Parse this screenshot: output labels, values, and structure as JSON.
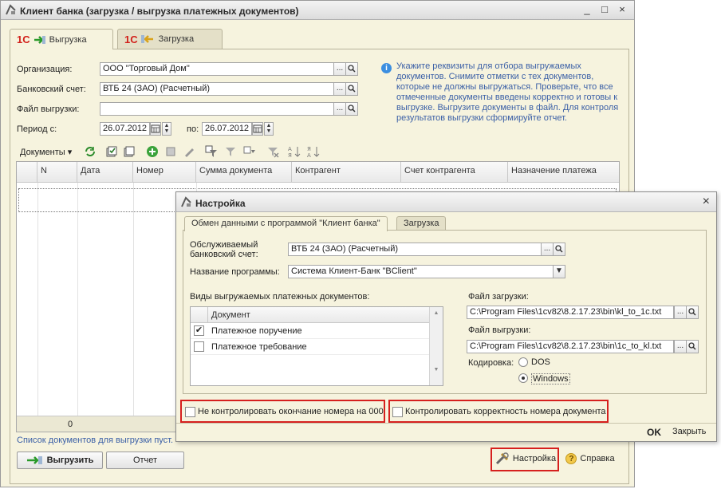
{
  "main_window": {
    "title": "Клиент банка (загрузка / выгрузка платежных документов)",
    "controls": {
      "minimize": "_",
      "maximize": "□",
      "close": "×"
    }
  },
  "tabs": [
    {
      "logo": "1С",
      "label": "Выгрузка",
      "active": true
    },
    {
      "logo": "1С",
      "label": "Загрузка",
      "active": false
    }
  ],
  "form": {
    "organization": {
      "label": "Организация:",
      "value": "ООО \"Торговый Дом\""
    },
    "bank_account": {
      "label": "Банковский счет:",
      "value": "ВТБ 24 (ЗАО) (Расчетный)"
    },
    "export_file": {
      "label": "Файл выгрузки:",
      "value": ""
    },
    "period": {
      "label_from": "Период с:",
      "from": "26.07.2012",
      "label_to": "по:",
      "to": "26.07.2012"
    },
    "select_button": "...",
    "search_icon": "magnifier-icon"
  },
  "info_text": "Укажите реквизиты для отбора выгружаемых документов. Снимите отметки с тех документов, которые не должны выгружаться. Проверьте, что все отмеченные документы введены корректно и готовы к выгрузке. Выгрузите документы в файл. Для контроля результатов выгрузки сформируйте отчет.",
  "toolbar": {
    "documents_menu": "Документы",
    "dropdown": "▾"
  },
  "table": {
    "columns": [
      "N",
      "Дата",
      "Номер",
      "Сумма документа",
      "Контрагент",
      "Счет контрагента",
      "Назначение платежа"
    ],
    "footer_count": "0"
  },
  "status_text": "Список документов для выгрузки пуст.",
  "buttons": {
    "export": "Выгрузить",
    "report": "Отчет",
    "settings": "Настройка",
    "help": "Справка"
  },
  "dialog": {
    "title": "Настройка",
    "close": "×",
    "tabs": [
      "Обмен данными с программой \"Клиент банка\"",
      "Загрузка"
    ],
    "account_label_line1": "Обслуживаемый",
    "account_label_line2": "банковский счет:",
    "account_value": "ВТБ 24 (ЗАО) (Расчетный)",
    "program_label": "Название программы:",
    "program_value": "Система Клиент-Банк \"BClient\"",
    "doc_types_label": "Виды выгружаемых платежных документов:",
    "doc_column": "Документ",
    "doc_types": [
      {
        "name": "Платежное поручение",
        "checked": true
      },
      {
        "name": "Платежное требование",
        "checked": false
      }
    ],
    "import_file_label": "Файл загрузки:",
    "import_file": "C:\\Program Files\\1cv82\\8.2.17.23\\bin\\kl_to_1c.txt",
    "export_file_label": "Файл выгрузки:",
    "export_file": "C:\\Program Files\\1cv82\\8.2.17.23\\bin\\1c_to_kl.txt",
    "encoding_label": "Кодировка:",
    "encoding_options": [
      "DOS",
      "Windows"
    ],
    "encoding_selected": "Windows",
    "check_end_number": {
      "label": "Не контролировать окончание номера на 000",
      "checked": false
    },
    "check_number": {
      "label": "Контролировать корректность номера документа",
      "checked": false
    },
    "ok": "OK",
    "close_button": "Закрыть",
    "accent_red": "#d6201e"
  }
}
